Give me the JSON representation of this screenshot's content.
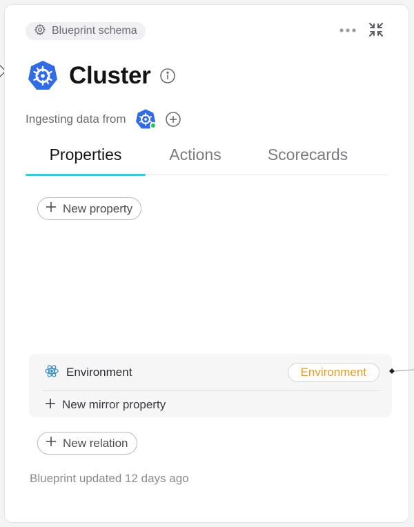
{
  "header": {
    "schema_label": "Blueprint schema",
    "more_icon": "more-icon",
    "collapse_icon": "collapse-icon"
  },
  "blueprint": {
    "title": "Cluster",
    "icon": "kubernetes-icon",
    "info_icon": "info-icon"
  },
  "ingest": {
    "label": "Ingesting data from",
    "source_icon": "kubernetes-icon",
    "source_status_color": "#22c55e",
    "add_icon": "plus-circle-icon"
  },
  "tabs": [
    {
      "label": "Properties",
      "active": true
    },
    {
      "label": "Actions",
      "active": false
    },
    {
      "label": "Scorecards",
      "active": false
    }
  ],
  "properties": {
    "new_property_label": "New property"
  },
  "mirror": {
    "relation_name": "Environment",
    "relation_icon": "atom-icon",
    "target_blueprint": "Environment",
    "new_mirror_label": "New mirror property"
  },
  "relations": {
    "new_relation_label": "New relation"
  },
  "footer": {
    "updated_text": "Blueprint updated 12 days ago"
  },
  "colors": {
    "accent": "#3cc7d6",
    "kubernetes_blue": "#326ce5",
    "tag_orange": "#e39c2a"
  }
}
